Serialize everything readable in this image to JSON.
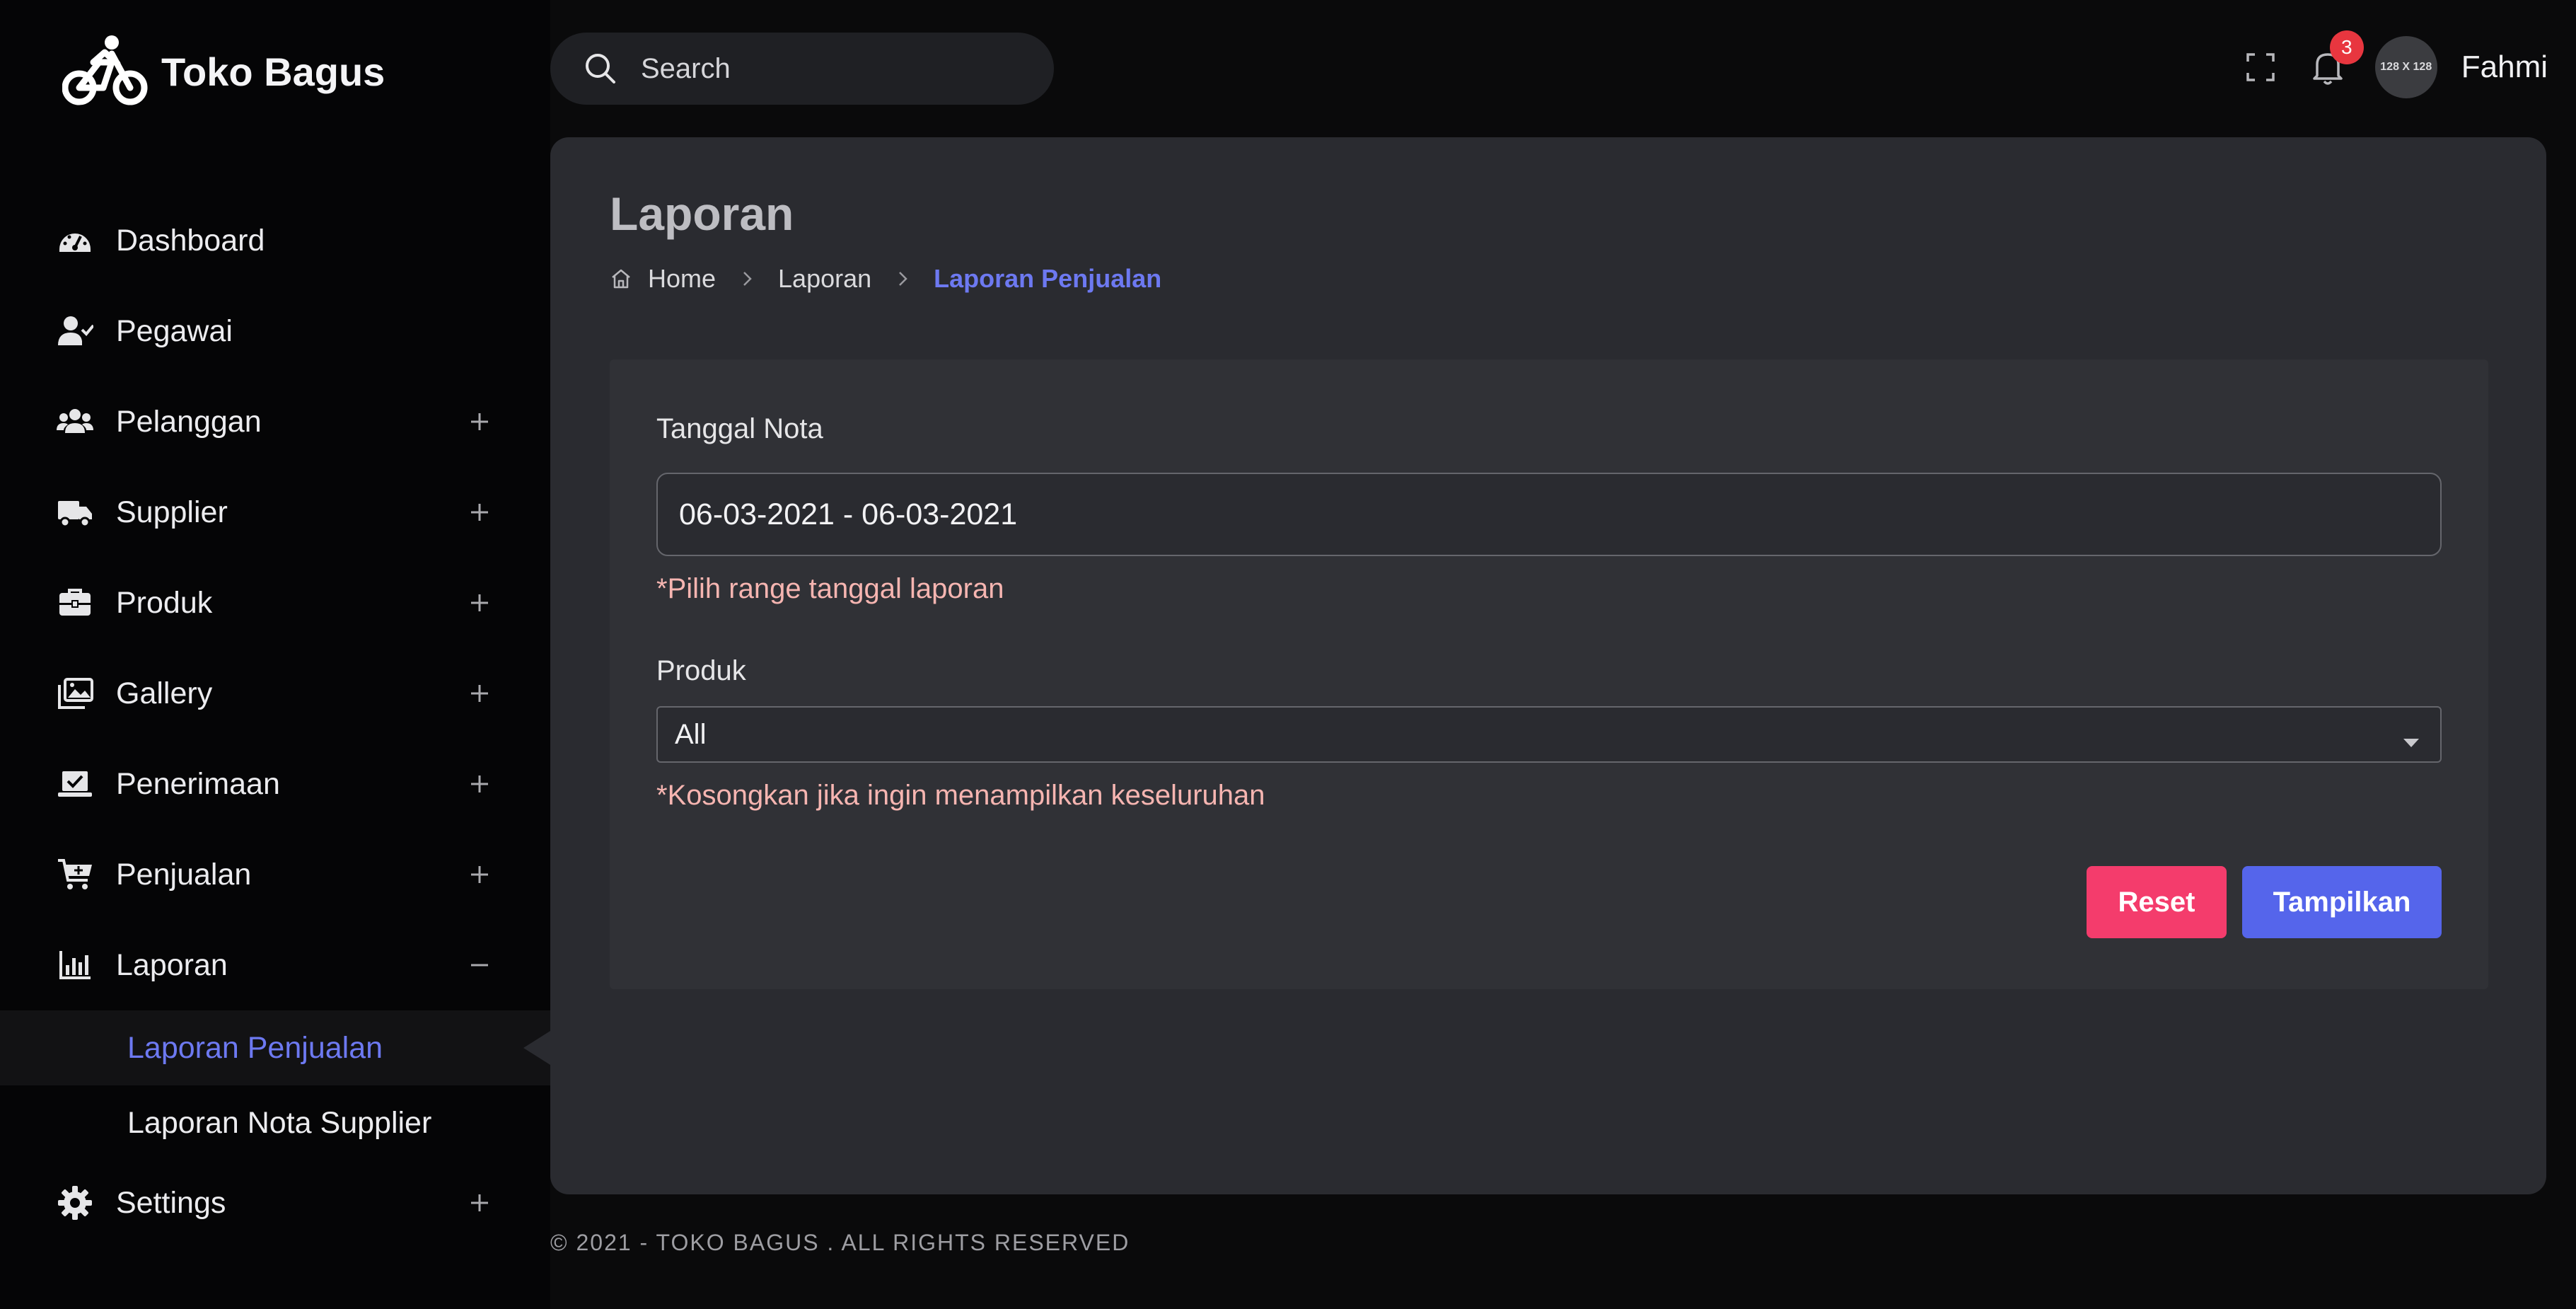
{
  "app": {
    "name": "Toko Bagus",
    "logo_icon": "bicycle-icon"
  },
  "search": {
    "placeholder": "Search"
  },
  "topbar": {
    "notification_count": "3",
    "avatar_text": "128 X 128",
    "username": "Fahmi"
  },
  "sidebar": {
    "items": [
      {
        "label": "Dashboard",
        "icon": "dashboard-icon",
        "toggle": ""
      },
      {
        "label": "Pegawai",
        "icon": "user-check-icon",
        "toggle": ""
      },
      {
        "label": "Pelanggan",
        "icon": "users-icon",
        "toggle": "+"
      },
      {
        "label": "Supplier",
        "icon": "truck-icon",
        "toggle": "+"
      },
      {
        "label": "Produk",
        "icon": "briefcase-icon",
        "toggle": "+"
      },
      {
        "label": "Gallery",
        "icon": "images-icon",
        "toggle": "+"
      },
      {
        "label": "Penerimaan",
        "icon": "laptop-check-icon",
        "toggle": "+"
      },
      {
        "label": "Penjualan",
        "icon": "cart-plus-icon",
        "toggle": "+"
      },
      {
        "label": "Laporan",
        "icon": "bar-chart-icon",
        "toggle": "-"
      },
      {
        "label": "Settings",
        "icon": "gear-icon",
        "toggle": "+"
      }
    ],
    "submenu": [
      {
        "label": "Laporan Penjualan",
        "active": true
      },
      {
        "label": "Laporan Nota Supplier",
        "active": false
      }
    ]
  },
  "page": {
    "title": "Laporan",
    "breadcrumb": [
      "Home",
      "Laporan",
      "Laporan Penjualan"
    ]
  },
  "form": {
    "date_label": "Tanggal Nota",
    "date_value": "06-03-2021 - 06-03-2021",
    "date_hint": "*Pilih range tanggal laporan",
    "product_label": "Produk",
    "product_value": "All",
    "product_hint": "*Kosongkan jika ingin menampilkan keseluruhan",
    "reset_label": "Reset",
    "submit_label": "Tampilkan"
  },
  "colors": {
    "accent": "#6d79f1",
    "reset_button": "#f43c6c",
    "submit_button": "#5565eb",
    "badge": "#e8363f",
    "hint_text": "#f6b5b1"
  },
  "footer": {
    "text": "© 2021 - TOKO BAGUS . ALL RIGHTS RESERVED"
  }
}
